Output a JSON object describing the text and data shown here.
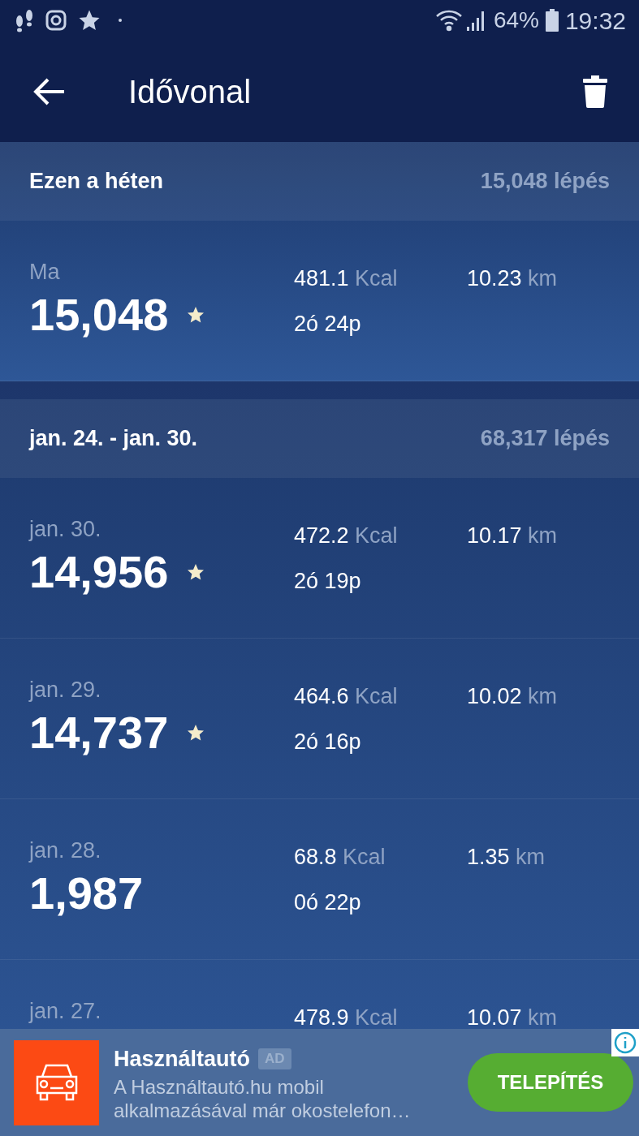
{
  "status_bar": {
    "battery": "64%",
    "time": "19:32"
  },
  "app_bar": {
    "title": "Idővonal"
  },
  "sections": [
    {
      "title": "Ezen a héten",
      "total": "15,048 lépés",
      "days": [
        {
          "date": "Ma",
          "steps": "15,048",
          "starred": true,
          "kcal": "481.1",
          "kcal_unit": "Kcal",
          "duration": "2ó 24p",
          "distance": "10.23",
          "distance_unit": "km"
        }
      ]
    },
    {
      "title": "jan. 24. - jan. 30.",
      "total": "68,317 lépés",
      "days": [
        {
          "date": "jan. 30.",
          "steps": "14,956",
          "starred": true,
          "kcal": "472.2",
          "kcal_unit": "Kcal",
          "duration": "2ó 19p",
          "distance": "10.17",
          "distance_unit": "km"
        },
        {
          "date": "jan. 29.",
          "steps": "14,737",
          "starred": true,
          "kcal": "464.6",
          "kcal_unit": "Kcal",
          "duration": "2ó 16p",
          "distance": "10.02",
          "distance_unit": "km"
        },
        {
          "date": "jan. 28.",
          "steps": "1,987",
          "starred": false,
          "kcal": "68.8",
          "kcal_unit": "Kcal",
          "duration": "0ó 22p",
          "distance": "1.35",
          "distance_unit": "km"
        },
        {
          "date": "jan. 27.",
          "kcal": "478.9",
          "kcal_unit": "Kcal",
          "distance": "10.07",
          "distance_unit": "km"
        }
      ]
    }
  ],
  "ad": {
    "title": "Használtautó",
    "badge": "AD",
    "text": "A Használtautó.hu mobil alkalmazásával már okostelefon…",
    "button": "TELEPÍTÉS"
  }
}
